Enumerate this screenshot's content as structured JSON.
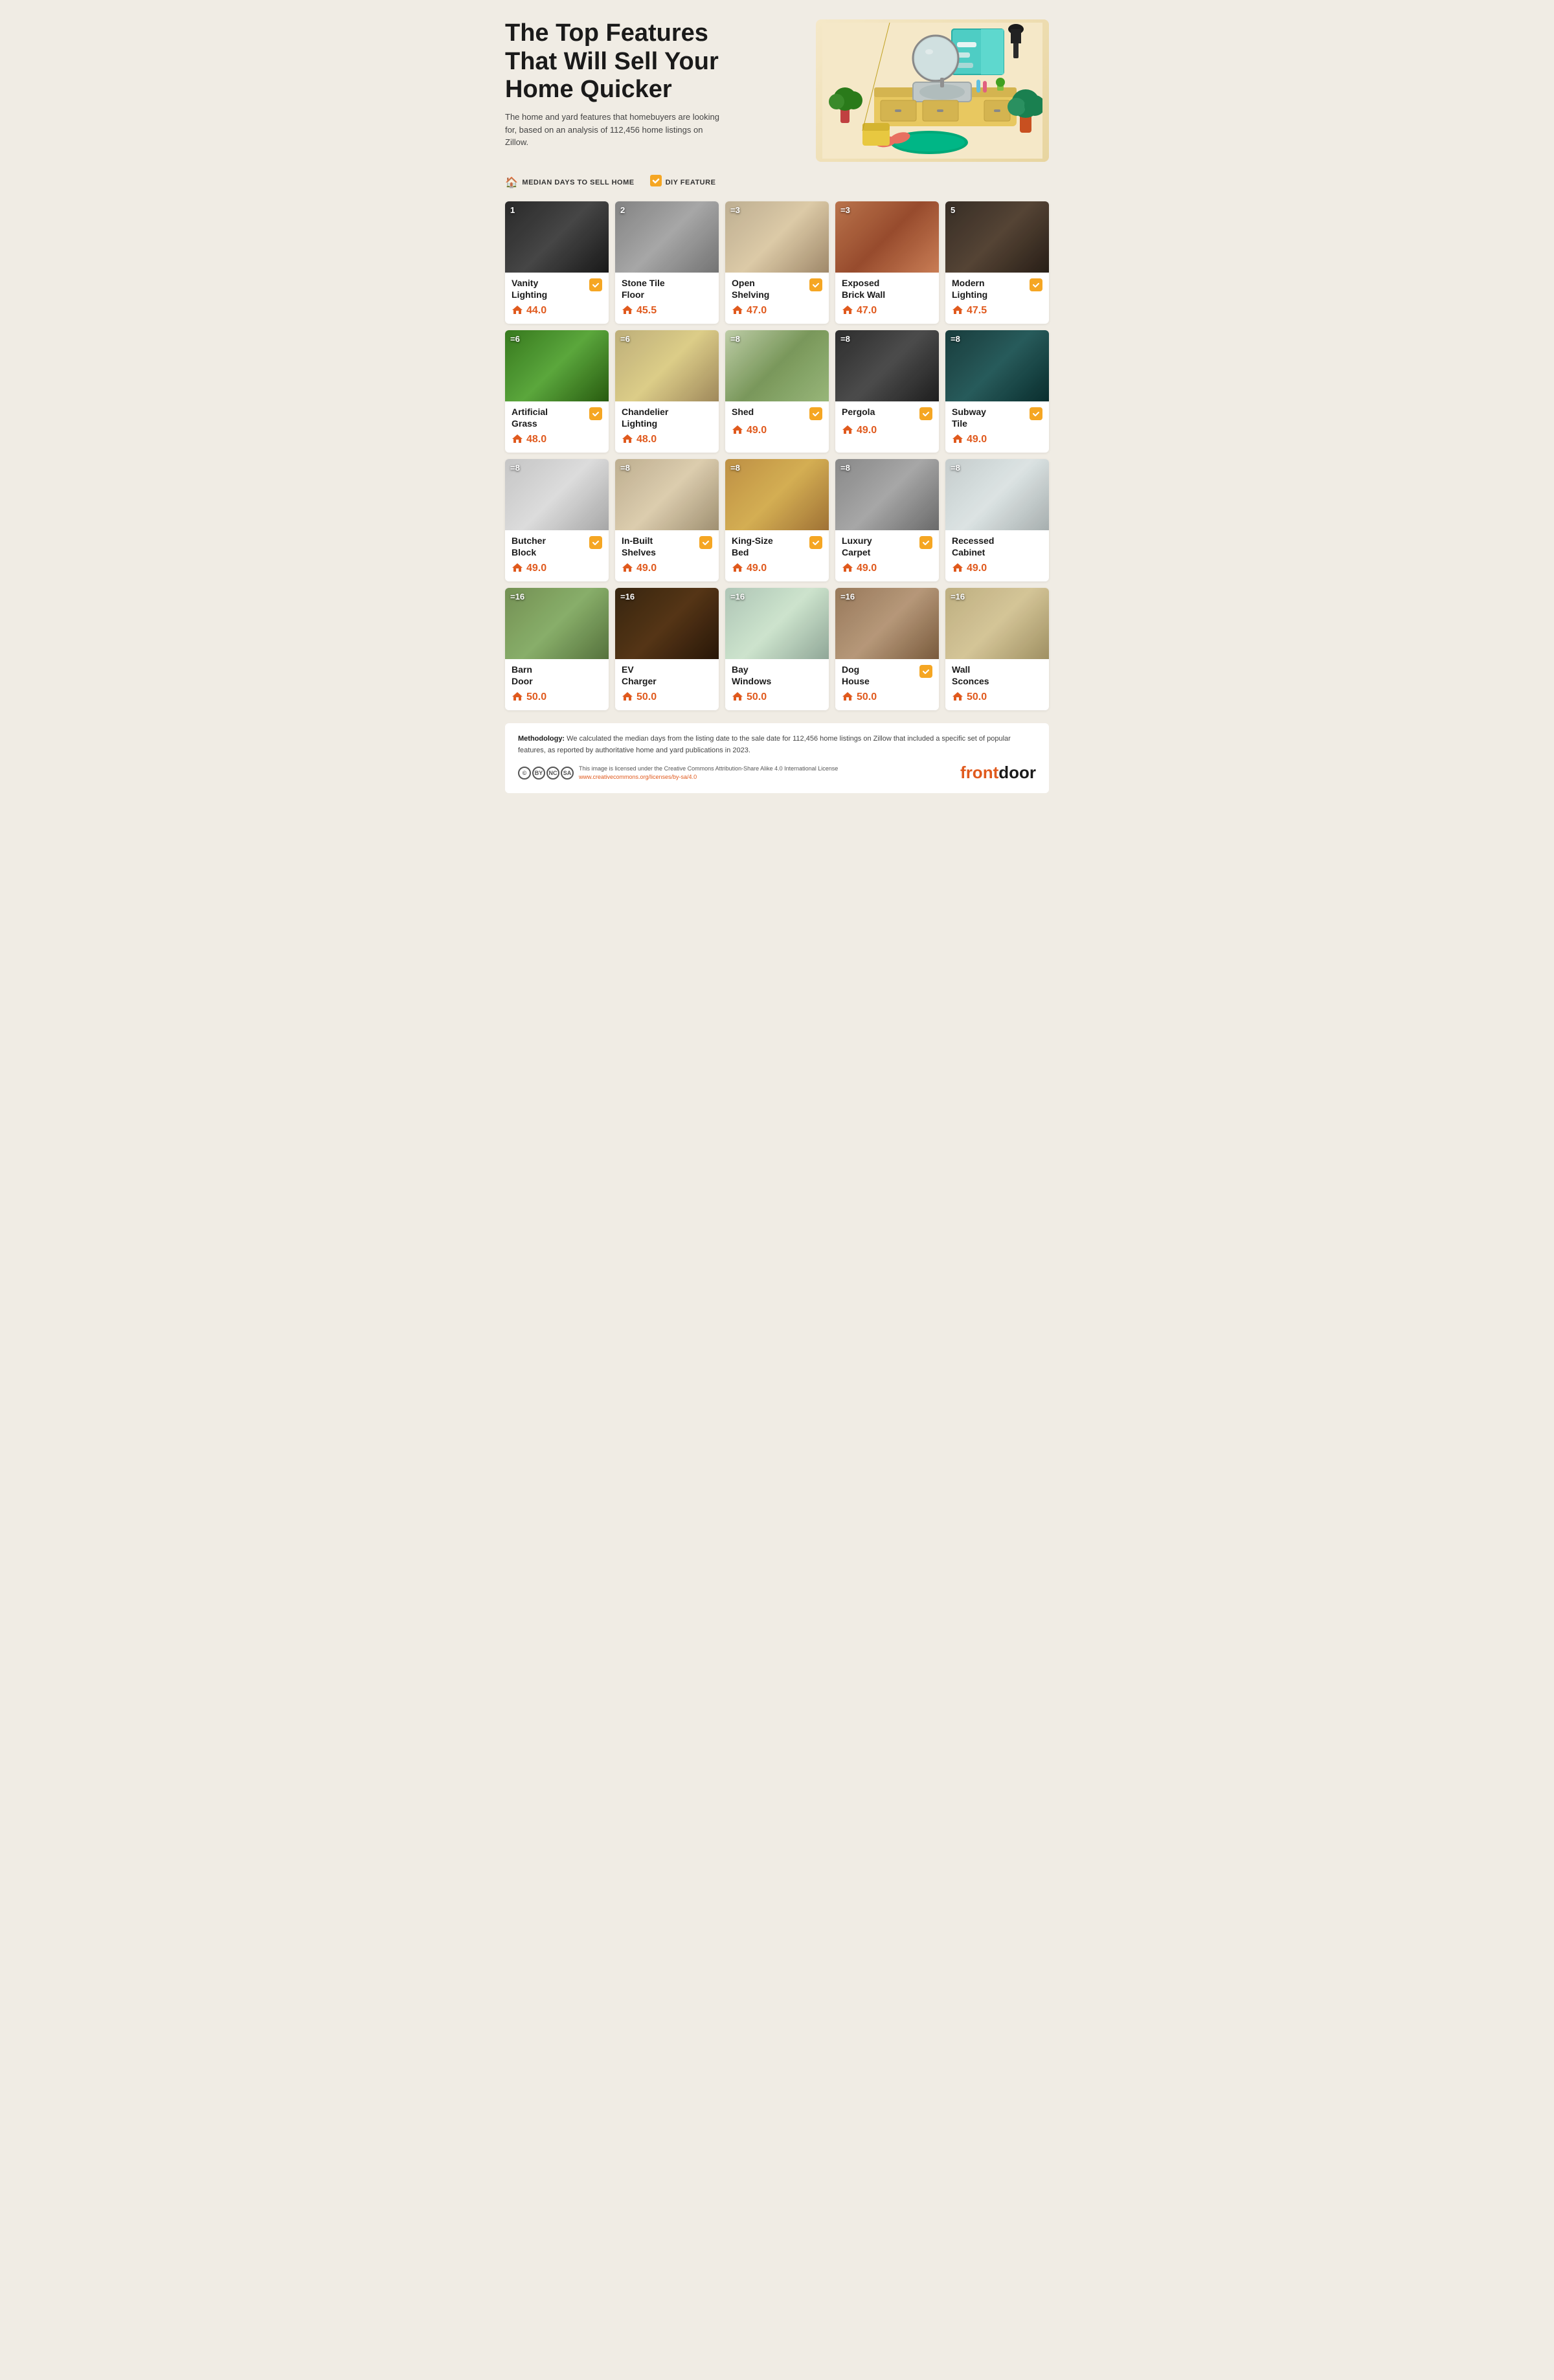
{
  "header": {
    "title_normal": "The Top Features",
    "title_bold": "That Will Sell Your Home Quicker",
    "subtitle": "The home and yard features that homebuyers are looking for, based on an analysis of 112,456 home listings on Zillow."
  },
  "legend": {
    "median_label": "MEDIAN DAYS TO SELL HOME",
    "diy_label": "DIY FEATURE"
  },
  "cards": [
    {
      "rank": "1",
      "title": "Vanity Lighting",
      "days": "44.0",
      "diy": true,
      "img_class": "img-vanity",
      "title_line1": "Vanity",
      "title_line2": "Lighting"
    },
    {
      "rank": "2",
      "title": "Stone Tile Floor",
      "days": "45.5",
      "diy": false,
      "img_class": "img-stone",
      "title_line1": "Stone Tile",
      "title_line2": "Floor"
    },
    {
      "rank": "=3",
      "title": "Open Shelving",
      "days": "47.0",
      "diy": true,
      "img_class": "img-open-shelf",
      "title_line1": "Open",
      "title_line2": "Shelving"
    },
    {
      "rank": "=3",
      "title": "Exposed Brick Wall",
      "days": "47.0",
      "diy": false,
      "img_class": "img-brick",
      "title_line1": "Exposed",
      "title_line2": "Brick Wall"
    },
    {
      "rank": "5",
      "title": "Modern Lighting",
      "days": "47.5",
      "diy": true,
      "img_class": "img-modern-light",
      "title_line1": "Modern",
      "title_line2": "Lighting"
    },
    {
      "rank": "=6",
      "title": "Artificial Grass",
      "days": "48.0",
      "diy": true,
      "img_class": "img-artgrass",
      "title_line1": "Artificial",
      "title_line2": "Grass"
    },
    {
      "rank": "=6",
      "title": "Chandelier Lighting",
      "days": "48.0",
      "diy": false,
      "img_class": "img-chandelier",
      "title_line1": "Chandelier",
      "title_line2": "Lighting"
    },
    {
      "rank": "=8",
      "title": "Shed",
      "days": "49.0",
      "diy": true,
      "img_class": "img-shed",
      "title_line1": "Shed",
      "title_line2": ""
    },
    {
      "rank": "=8",
      "title": "Pergola",
      "days": "49.0",
      "diy": true,
      "img_class": "img-pergola",
      "title_line1": "Pergola",
      "title_line2": ""
    },
    {
      "rank": "=8",
      "title": "Subway Tile",
      "days": "49.0",
      "diy": true,
      "img_class": "img-subway",
      "title_line1": "Subway",
      "title_line2": "Tile"
    },
    {
      "rank": "=8",
      "title": "Butcher Block",
      "days": "49.0",
      "diy": true,
      "img_class": "img-butcher",
      "title_line1": "Butcher",
      "title_line2": "Block"
    },
    {
      "rank": "=8",
      "title": "In-Built Shelves",
      "days": "49.0",
      "diy": true,
      "img_class": "img-inbuilt",
      "title_line1": "In-Built",
      "title_line2": "Shelves"
    },
    {
      "rank": "=8",
      "title": "King-Size Bed",
      "days": "49.0",
      "diy": true,
      "img_class": "img-kingbed",
      "title_line1": "King-Size",
      "title_line2": "Bed"
    },
    {
      "rank": "=8",
      "title": "Luxury Carpet",
      "days": "49.0",
      "diy": true,
      "img_class": "img-luxury-carpet",
      "title_line1": "Luxury",
      "title_line2": "Carpet"
    },
    {
      "rank": "=8",
      "title": "Recessed Cabinet",
      "days": "49.0",
      "diy": false,
      "img_class": "img-recessed",
      "title_line1": "Recessed",
      "title_line2": "Cabinet"
    },
    {
      "rank": "=16",
      "title": "Barn Door",
      "days": "50.0",
      "diy": false,
      "img_class": "img-barn",
      "title_line1": "Barn",
      "title_line2": "Door"
    },
    {
      "rank": "=16",
      "title": "EV Charger",
      "days": "50.0",
      "diy": false,
      "img_class": "img-ev",
      "title_line1": "EV",
      "title_line2": "Charger"
    },
    {
      "rank": "=16",
      "title": "Bay Windows",
      "days": "50.0",
      "diy": false,
      "img_class": "img-bay",
      "title_line1": "Bay",
      "title_line2": "Windows"
    },
    {
      "rank": "=16",
      "title": "Dog House",
      "days": "50.0",
      "diy": true,
      "img_class": "img-doghouse",
      "title_line1": "Dog",
      "title_line2": "House"
    },
    {
      "rank": "=16",
      "title": "Wall Sconces",
      "days": "50.0",
      "diy": false,
      "img_class": "img-wall-sconces",
      "title_line1": "Wall",
      "title_line2": "Sconces"
    }
  ],
  "footer": {
    "methodology_label": "Methodology:",
    "methodology_text": "We calculated the median days from the listing date to the sale date for 112,456 home listings on Zillow that included a specific set of popular features, as reported by authoritative home and yard publications in 2023.",
    "license_text": "This image is licensed under the Creative Commons Attribution-Share Alike 4.0 International License",
    "license_url": "www.creativecommons.org/licenses/by-sa/4.0",
    "brand": "front",
    "brand2": "door"
  },
  "icons": {
    "house": "🏠",
    "checkmark": "✓",
    "cc_by": "BY",
    "cc_nc": "NC",
    "cc_sa": "SA"
  }
}
